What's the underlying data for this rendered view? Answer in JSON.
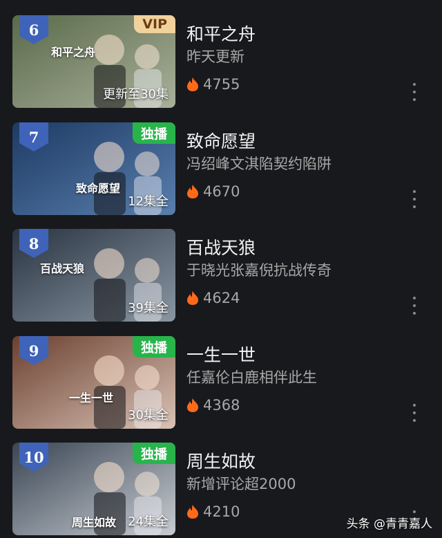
{
  "items": [
    {
      "rank": "6",
      "tag": "VIP",
      "tag_type": "vip",
      "episodes": "更新至30集",
      "poster_title": "和平之舟",
      "title": "和平之舟",
      "desc": "昨天更新",
      "heat": "4755",
      "bg": [
        "#5a6a4a",
        "#a9b09a"
      ]
    },
    {
      "rank": "7",
      "tag": "独播",
      "tag_type": "exclusive",
      "episodes": "12集全",
      "poster_title": "致命愿望",
      "title": "致命愿望",
      "desc": "冯绍峰文淇陷契约陷阱",
      "heat": "4670",
      "bg": [
        "#1d3a63",
        "#5a7fae"
      ]
    },
    {
      "rank": "8",
      "tag": "",
      "tag_type": "",
      "episodes": "39集全",
      "poster_title": "百战天狼",
      "title": "百战天狼",
      "desc": "于晓光张嘉倪抗战传奇",
      "heat": "4624",
      "bg": [
        "#2a3442",
        "#8a97a3"
      ]
    },
    {
      "rank": "9",
      "tag": "独播",
      "tag_type": "exclusive",
      "episodes": "30集全",
      "poster_title": "一生一世",
      "title": "一生一世",
      "desc": "任嘉伦白鹿相伴此生",
      "heat": "4368",
      "bg": [
        "#6b4030",
        "#d9c2b5"
      ]
    },
    {
      "rank": "10",
      "tag": "独播",
      "tag_type": "exclusive",
      "episodes": "24集全",
      "poster_title": "周生如故",
      "title": "周生如故",
      "desc": "新增评论超2000",
      "heat": "4210",
      "bg": [
        "#3a4654",
        "#c8ccd2"
      ]
    }
  ],
  "watermark": "头条 @青青嘉人",
  "colors": {
    "rank_badge": "#3f63b8",
    "flame": "#ff6a1a",
    "vip": "#f1d19c",
    "exclusive": "#28b44b"
  }
}
